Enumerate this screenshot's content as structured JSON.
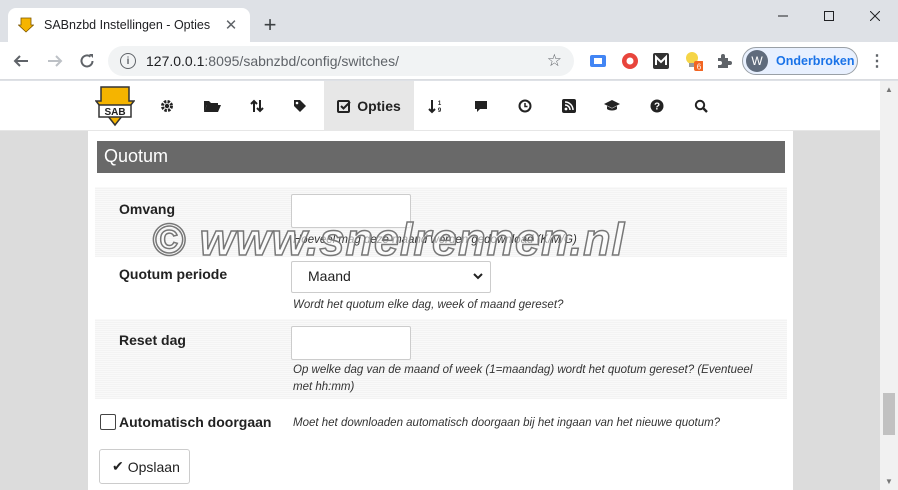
{
  "browser": {
    "tab_title": "SABnzbd Instellingen - Opties",
    "url_host": "127.0.0.1",
    "url_rest": ":8095/sabnzbd/config/switches/",
    "profile_initial": "W",
    "profile_label": "Onderbroken",
    "extension_badge": "6"
  },
  "nav": {
    "active_label": "Opties",
    "items": [
      "gear-icon",
      "folder-icon",
      "sort-icon",
      "tag-icon",
      "check-square-icon",
      "sort-numeric-icon",
      "comment-icon",
      "clock-icon",
      "rss-icon",
      "graduation-cap-icon",
      "question-circle-icon",
      "search-icon"
    ]
  },
  "section": {
    "title": "Quotum"
  },
  "fields": {
    "omvang": {
      "label": "Omvang",
      "value": "",
      "hint": "Hoeveel mag deze maand worden gedownload (K/M/G)"
    },
    "periode": {
      "label": "Quotum periode",
      "selected": "Maand",
      "hint": "Wordt het quotum elke dag, week of maand gereset?"
    },
    "reset": {
      "label": "Reset dag",
      "value": "",
      "hint_line1": "Op welke dag van de maand of week (1=maandag) wordt het quotum gereset? (Eventueel",
      "hint_line2": "met hh:mm)"
    },
    "auto": {
      "label": "Automatisch doorgaan",
      "checked": false,
      "hint": "Moet het downloaden automatisch doorgaan bij het ingaan van het nieuwe quotum?"
    }
  },
  "save_label": "Opslaan",
  "watermark": "© www.snelrennen.nl"
}
